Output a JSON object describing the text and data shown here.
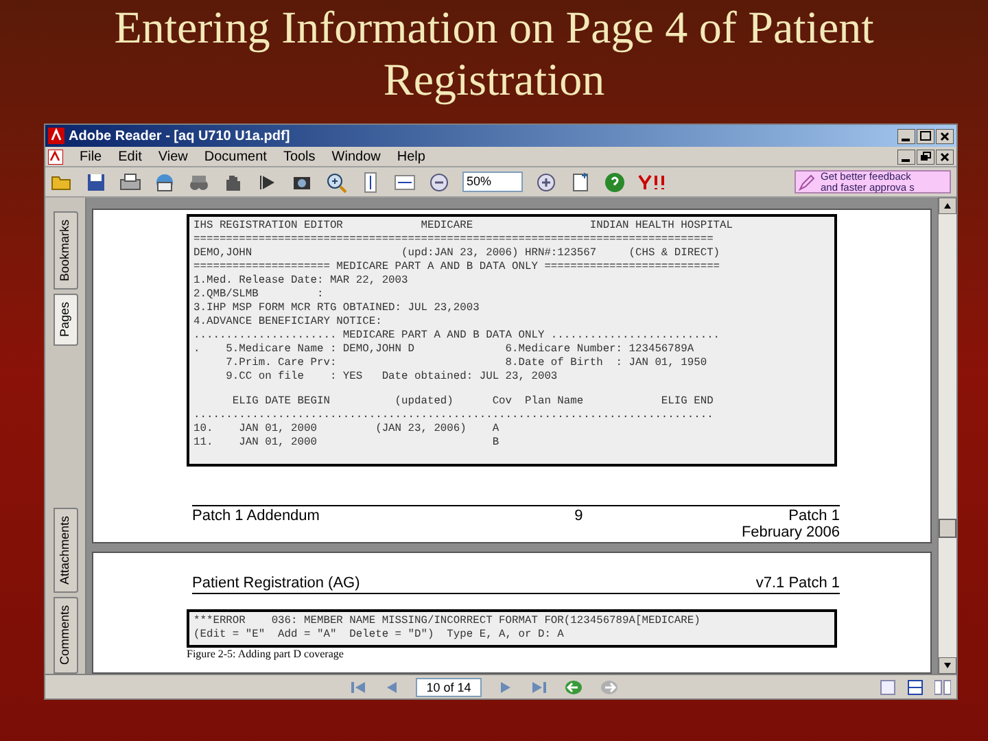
{
  "slide_title": "Entering Information on Page 4 of Patient Registration",
  "window": {
    "title": "Adobe Reader - [aq U710 U1a.pdf]"
  },
  "menu": [
    "File",
    "Edit",
    "View",
    "Document",
    "Tools",
    "Window",
    "Help"
  ],
  "toolbar": {
    "zoom": "50%",
    "promo": [
      "Get better feedback",
      "and faster approva s"
    ]
  },
  "side_tabs": [
    {
      "label": "Bookmarks",
      "selected": false
    },
    {
      "label": "Pages",
      "selected": true
    },
    {
      "label": "Attachments",
      "selected": false
    },
    {
      "label": "Comments",
      "selected": false
    }
  ],
  "page_1": {
    "screen_lines": [
      "IHS REGISTRATION EDITOR            MEDICARE                  INDIAN HEALTH HOSPITAL",
      "================================================================================",
      "DEMO,JOHN                       (upd:JAN 23, 2006) HRN#:123567     (CHS & DIRECT)",
      "===================== MEDICARE PART A AND B DATA ONLY ===========================",
      "1.Med. Release Date: MAR 22, 2003",
      "2.QMB/SLMB         :",
      "3.IHP MSP FORM MCR RTG OBTAINED: JUL 23,2003",
      "4.ADVANCE BENEFICIARY NOTICE:",
      "...................... MEDICARE PART A AND B DATA ONLY ..........................",
      ".    5.Medicare Name : DEMO,JOHN D              6.Medicare Number: 123456789A",
      "     7.Prim. Care Prv:                          8.Date of Birth  : JAN 01, 1950",
      "     9.CC on file    : YES   Date obtained: JUL 23, 2003"
    ],
    "table_lines": [
      "      ELIG DATE BEGIN          (updated)      Cov  Plan Name            ELIG END",
      "................................................................................",
      "10.    JAN 01, 2000         (JAN 23, 2006)    A",
      "11.    JAN 01, 2000                           B"
    ],
    "footer": {
      "left": "Patch 1 Addendum",
      "center": "9",
      "right": [
        "Patch 1",
        "February 2006"
      ]
    }
  },
  "page_2": {
    "header": {
      "left": "Patient Registration (AG)",
      "right": "v7.1 Patch 1"
    },
    "screen_lines": [
      "***ERROR    036: MEMBER NAME MISSING/INCORRECT FORMAT FOR(123456789A[MEDICARE)",
      "(Edit = \"E\"  Add = \"A\"  Delete = \"D\")  Type E, A, or D: A"
    ],
    "caption": "Figure 2-5: Adding part D coverage"
  },
  "status_bar": {
    "page": "10 of 14"
  }
}
